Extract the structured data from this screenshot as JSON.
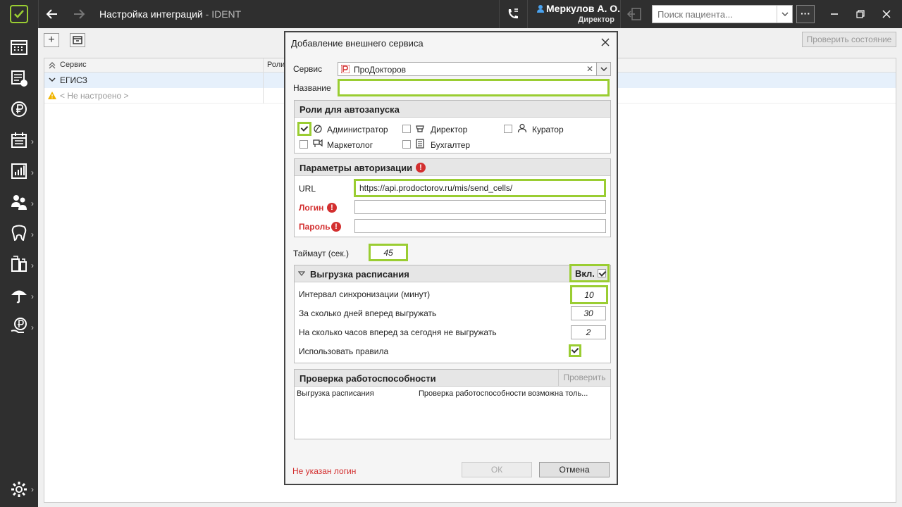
{
  "titlebar": {
    "title": "Настройка интеграций",
    "subtitle": " - IDENT",
    "user_name": "Меркулов А. О.",
    "user_role": "Директор",
    "search_placeholder": "Поиск пациента...",
    "more_label": "···"
  },
  "toolbar": {
    "add_label": "+",
    "check_state_label": "Проверить состояние"
  },
  "grid": {
    "columns": [
      "Сервис",
      "Роли"
    ],
    "group_label": "ЕГИСЗ",
    "row_label": "< Не настроено >"
  },
  "dialog": {
    "title": "Добавление внешнего сервиса",
    "service_label": "Сервис",
    "service_value": "ПроДокторов",
    "name_label": "Название",
    "name_value": "",
    "roles": {
      "header": "Роли для автозапуска",
      "items": [
        {
          "label": "Администратор",
          "checked": true
        },
        {
          "label": "Директор",
          "checked": false
        },
        {
          "label": "Куратор",
          "checked": false
        },
        {
          "label": "Маркетолог",
          "checked": false
        },
        {
          "label": "Бухгалтер",
          "checked": false
        }
      ]
    },
    "auth": {
      "header": "Параметры авторизации",
      "url_label": "URL",
      "url_value": "https://api.prodoctorov.ru/mis/send_cells/",
      "login_label": "Логин",
      "login_value": "",
      "password_label": "Пароль",
      "password_value": ""
    },
    "timeout_label": "Таймаут (сек.)",
    "timeout_value": "45",
    "schedule": {
      "header": "Выгрузка расписания",
      "enabled_label": "Вкл.",
      "enabled": true,
      "interval_label": "Интервал синхронизации (минут)",
      "interval_value": "10",
      "days_label": "За сколько дней вперед выгружать",
      "days_value": "30",
      "hours_label": "На сколько часов вперед за сегодня не выгружать",
      "hours_value": "2",
      "rules_label": "Использовать правила",
      "rules_checked": true
    },
    "health": {
      "header": "Проверка работоспособности",
      "check_label": "Проверить",
      "row_name": "Выгрузка расписания",
      "row_status": "Проверка работоспособности возможна толь..."
    },
    "error_text": "Не указан логин",
    "ok_label": "ОК",
    "cancel_label": "Отмена"
  },
  "colors": {
    "accent": "#9acd32",
    "error": "#d32f2f",
    "chrome": "#2f2f2f"
  }
}
